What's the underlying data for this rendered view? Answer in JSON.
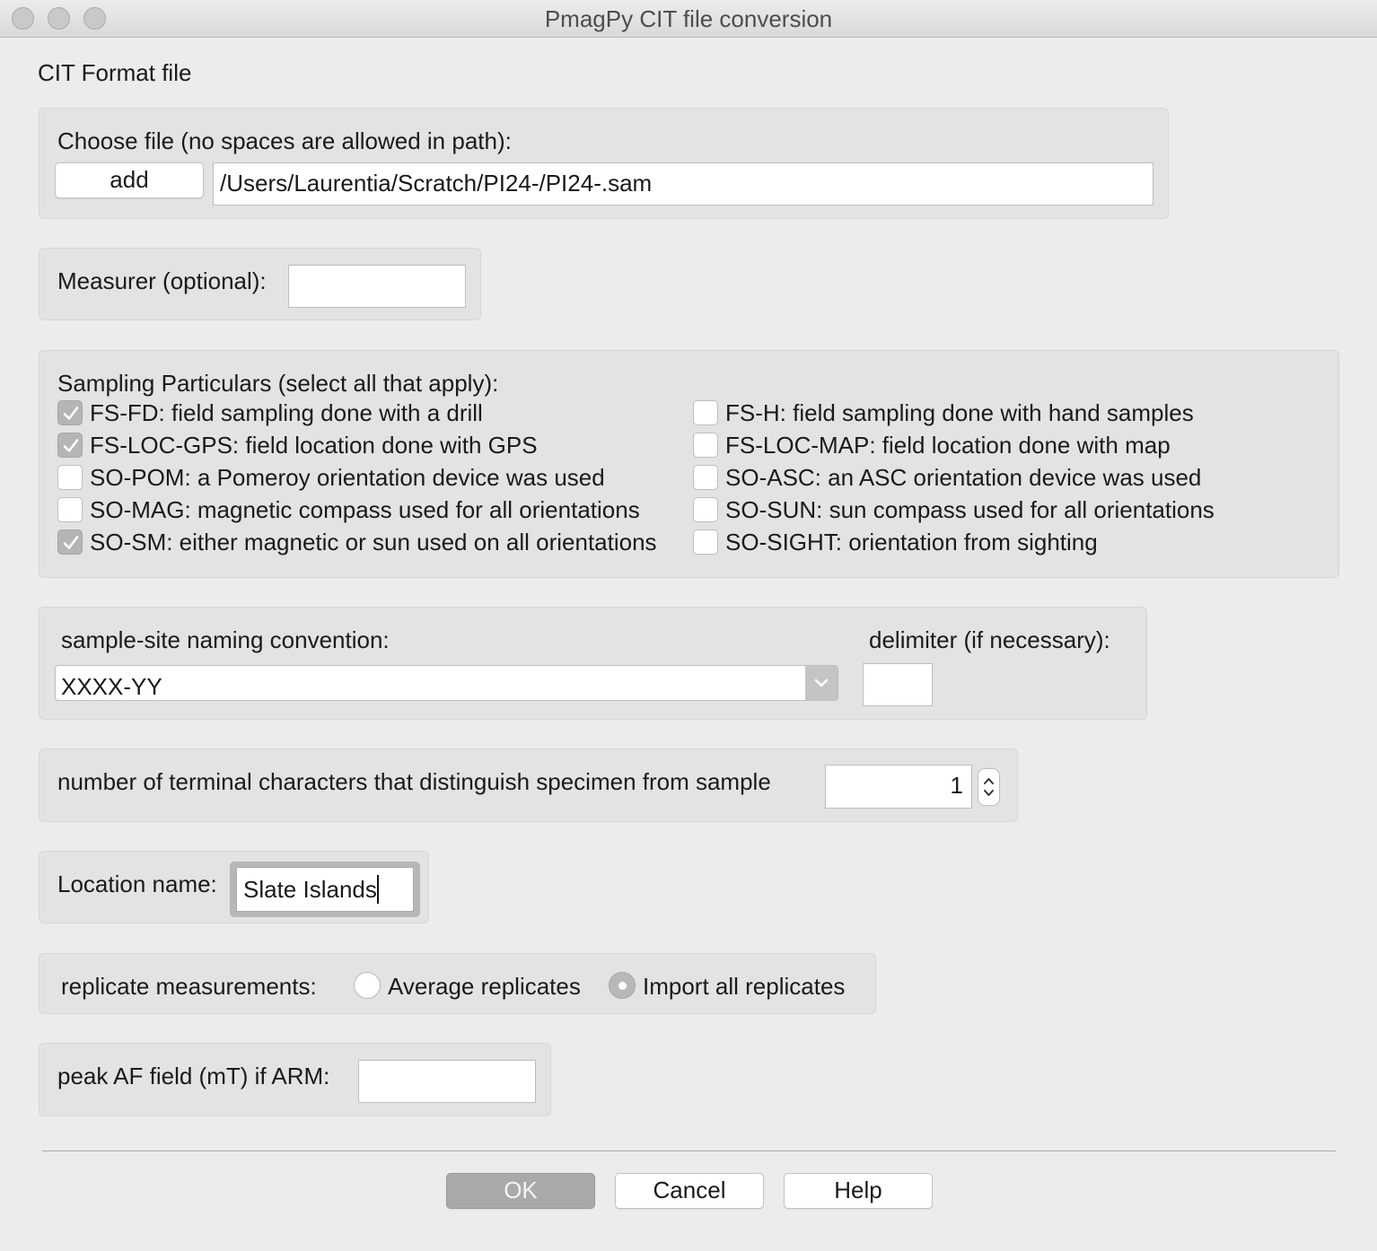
{
  "window": {
    "title": "PmagPy CIT file conversion"
  },
  "header": {
    "heading": "CIT Format file"
  },
  "file_chooser": {
    "label": "Choose file (no spaces are allowed in path):",
    "add_label": "add",
    "path_value": "/Users/Laurentia/Scratch/PI24-/PI24-.sam"
  },
  "measurer": {
    "label": "Measurer (optional):",
    "value": ""
  },
  "sampling": {
    "label": "Sampling Particulars (select all that apply):",
    "left": [
      {
        "code": "FS-FD: field sampling done with a drill",
        "checked": true
      },
      {
        "code": "FS-LOC-GPS: field location done with GPS",
        "checked": true
      },
      {
        "code": "SO-POM:  a Pomeroy orientation device was used",
        "checked": false
      },
      {
        "code": "SO-MAG: magnetic compass used for all orientations",
        "checked": false
      },
      {
        "code": "SO-SM: either magnetic or sun used on all orientations",
        "checked": true
      }
    ],
    "right": [
      {
        "code": "FS-H: field sampling done with hand samples",
        "checked": false
      },
      {
        "code": "FS-LOC-MAP:  field location done with map",
        "checked": false
      },
      {
        "code": "SO-ASC:  an ASC orientation device was used",
        "checked": false
      },
      {
        "code": "SO-SUN: sun compass used for all orientations",
        "checked": false
      },
      {
        "code": "SO-SIGHT: orientation from sighting",
        "checked": false
      }
    ]
  },
  "naming": {
    "label": "sample-site naming convention:",
    "selected": "XXXX-YY",
    "delimiter_label": "delimiter (if necessary):",
    "delimiter_value": ""
  },
  "terminal_chars": {
    "label": "number of terminal characters that distinguish specimen from sample",
    "value": "1"
  },
  "location": {
    "label": "Location name:",
    "value": "Slate Islands"
  },
  "replicates": {
    "label": "replicate measurements:",
    "options": [
      {
        "label": "Average replicates",
        "selected": false
      },
      {
        "label": "Import all replicates",
        "selected": true
      }
    ]
  },
  "peak_af": {
    "label": "peak AF field (mT) if ARM:",
    "value": ""
  },
  "buttons": {
    "ok": "OK",
    "cancel": "Cancel",
    "help": "Help"
  }
}
